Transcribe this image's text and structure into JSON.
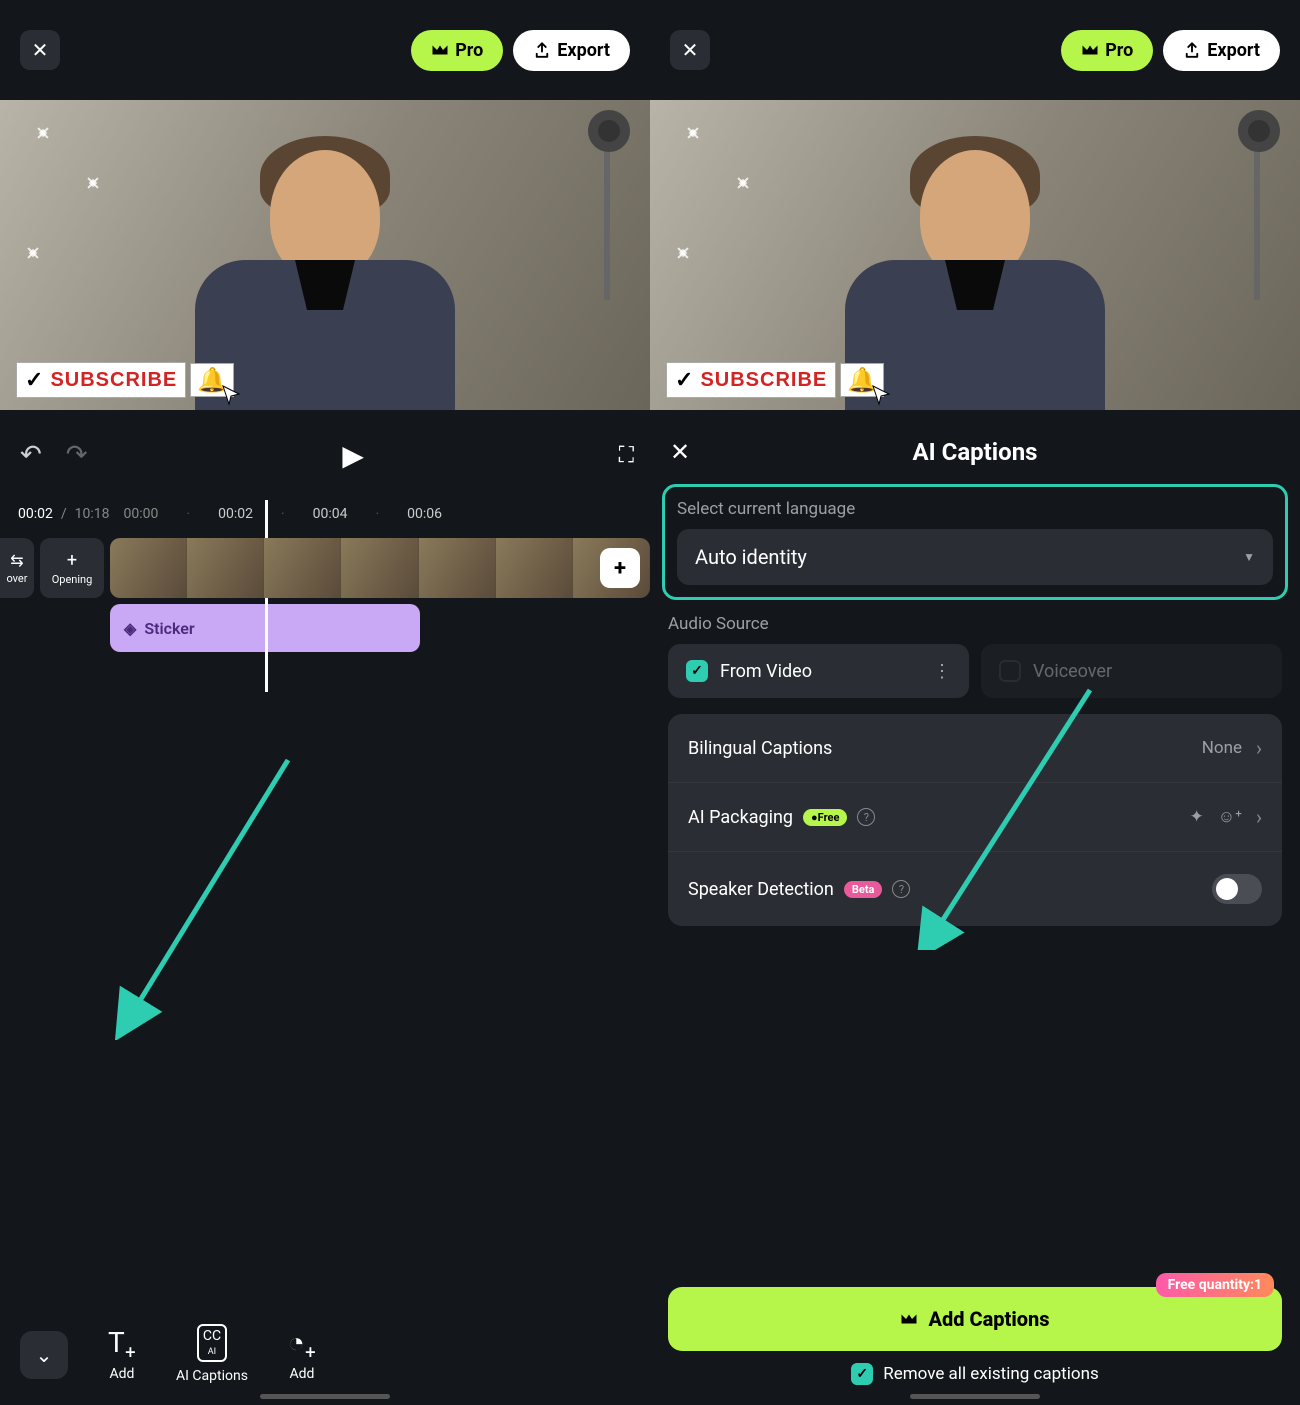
{
  "left": {
    "topbar": {
      "pro": "Pro",
      "export": "Export"
    },
    "subscribe_label": "SUBSCRIBE",
    "player": {
      "current": "00:02",
      "duration": "10:18"
    },
    "timeline": {
      "ticks": [
        "00:00",
        "00:02",
        "00:04",
        "00:06"
      ],
      "track_buttons": {
        "over": "over",
        "opening": "Opening"
      },
      "sticker": "Sticker"
    },
    "toolbar": {
      "add_text": "Add",
      "ai_captions": "AI Captions",
      "add_effect": "Add"
    }
  },
  "right": {
    "topbar": {
      "pro": "Pro",
      "export": "Export"
    },
    "subscribe_label": "SUBSCRIBE",
    "panel": {
      "title": "AI Captions",
      "language": {
        "label": "Select current language",
        "value": "Auto identity"
      },
      "audio": {
        "label": "Audio Source",
        "from_video": "From Video",
        "voiceover": "Voiceover"
      },
      "options": {
        "bilingual": {
          "label": "Bilingual Captions",
          "value": "None"
        },
        "ai_packaging": {
          "label": "AI Packaging",
          "pill": "●Free"
        },
        "speaker_detection": {
          "label": "Speaker Detection",
          "pill": "Beta"
        }
      },
      "add_captions": "Add Captions",
      "free_quantity": "Free quantity:1",
      "remove_existing": "Remove all existing captions"
    }
  }
}
